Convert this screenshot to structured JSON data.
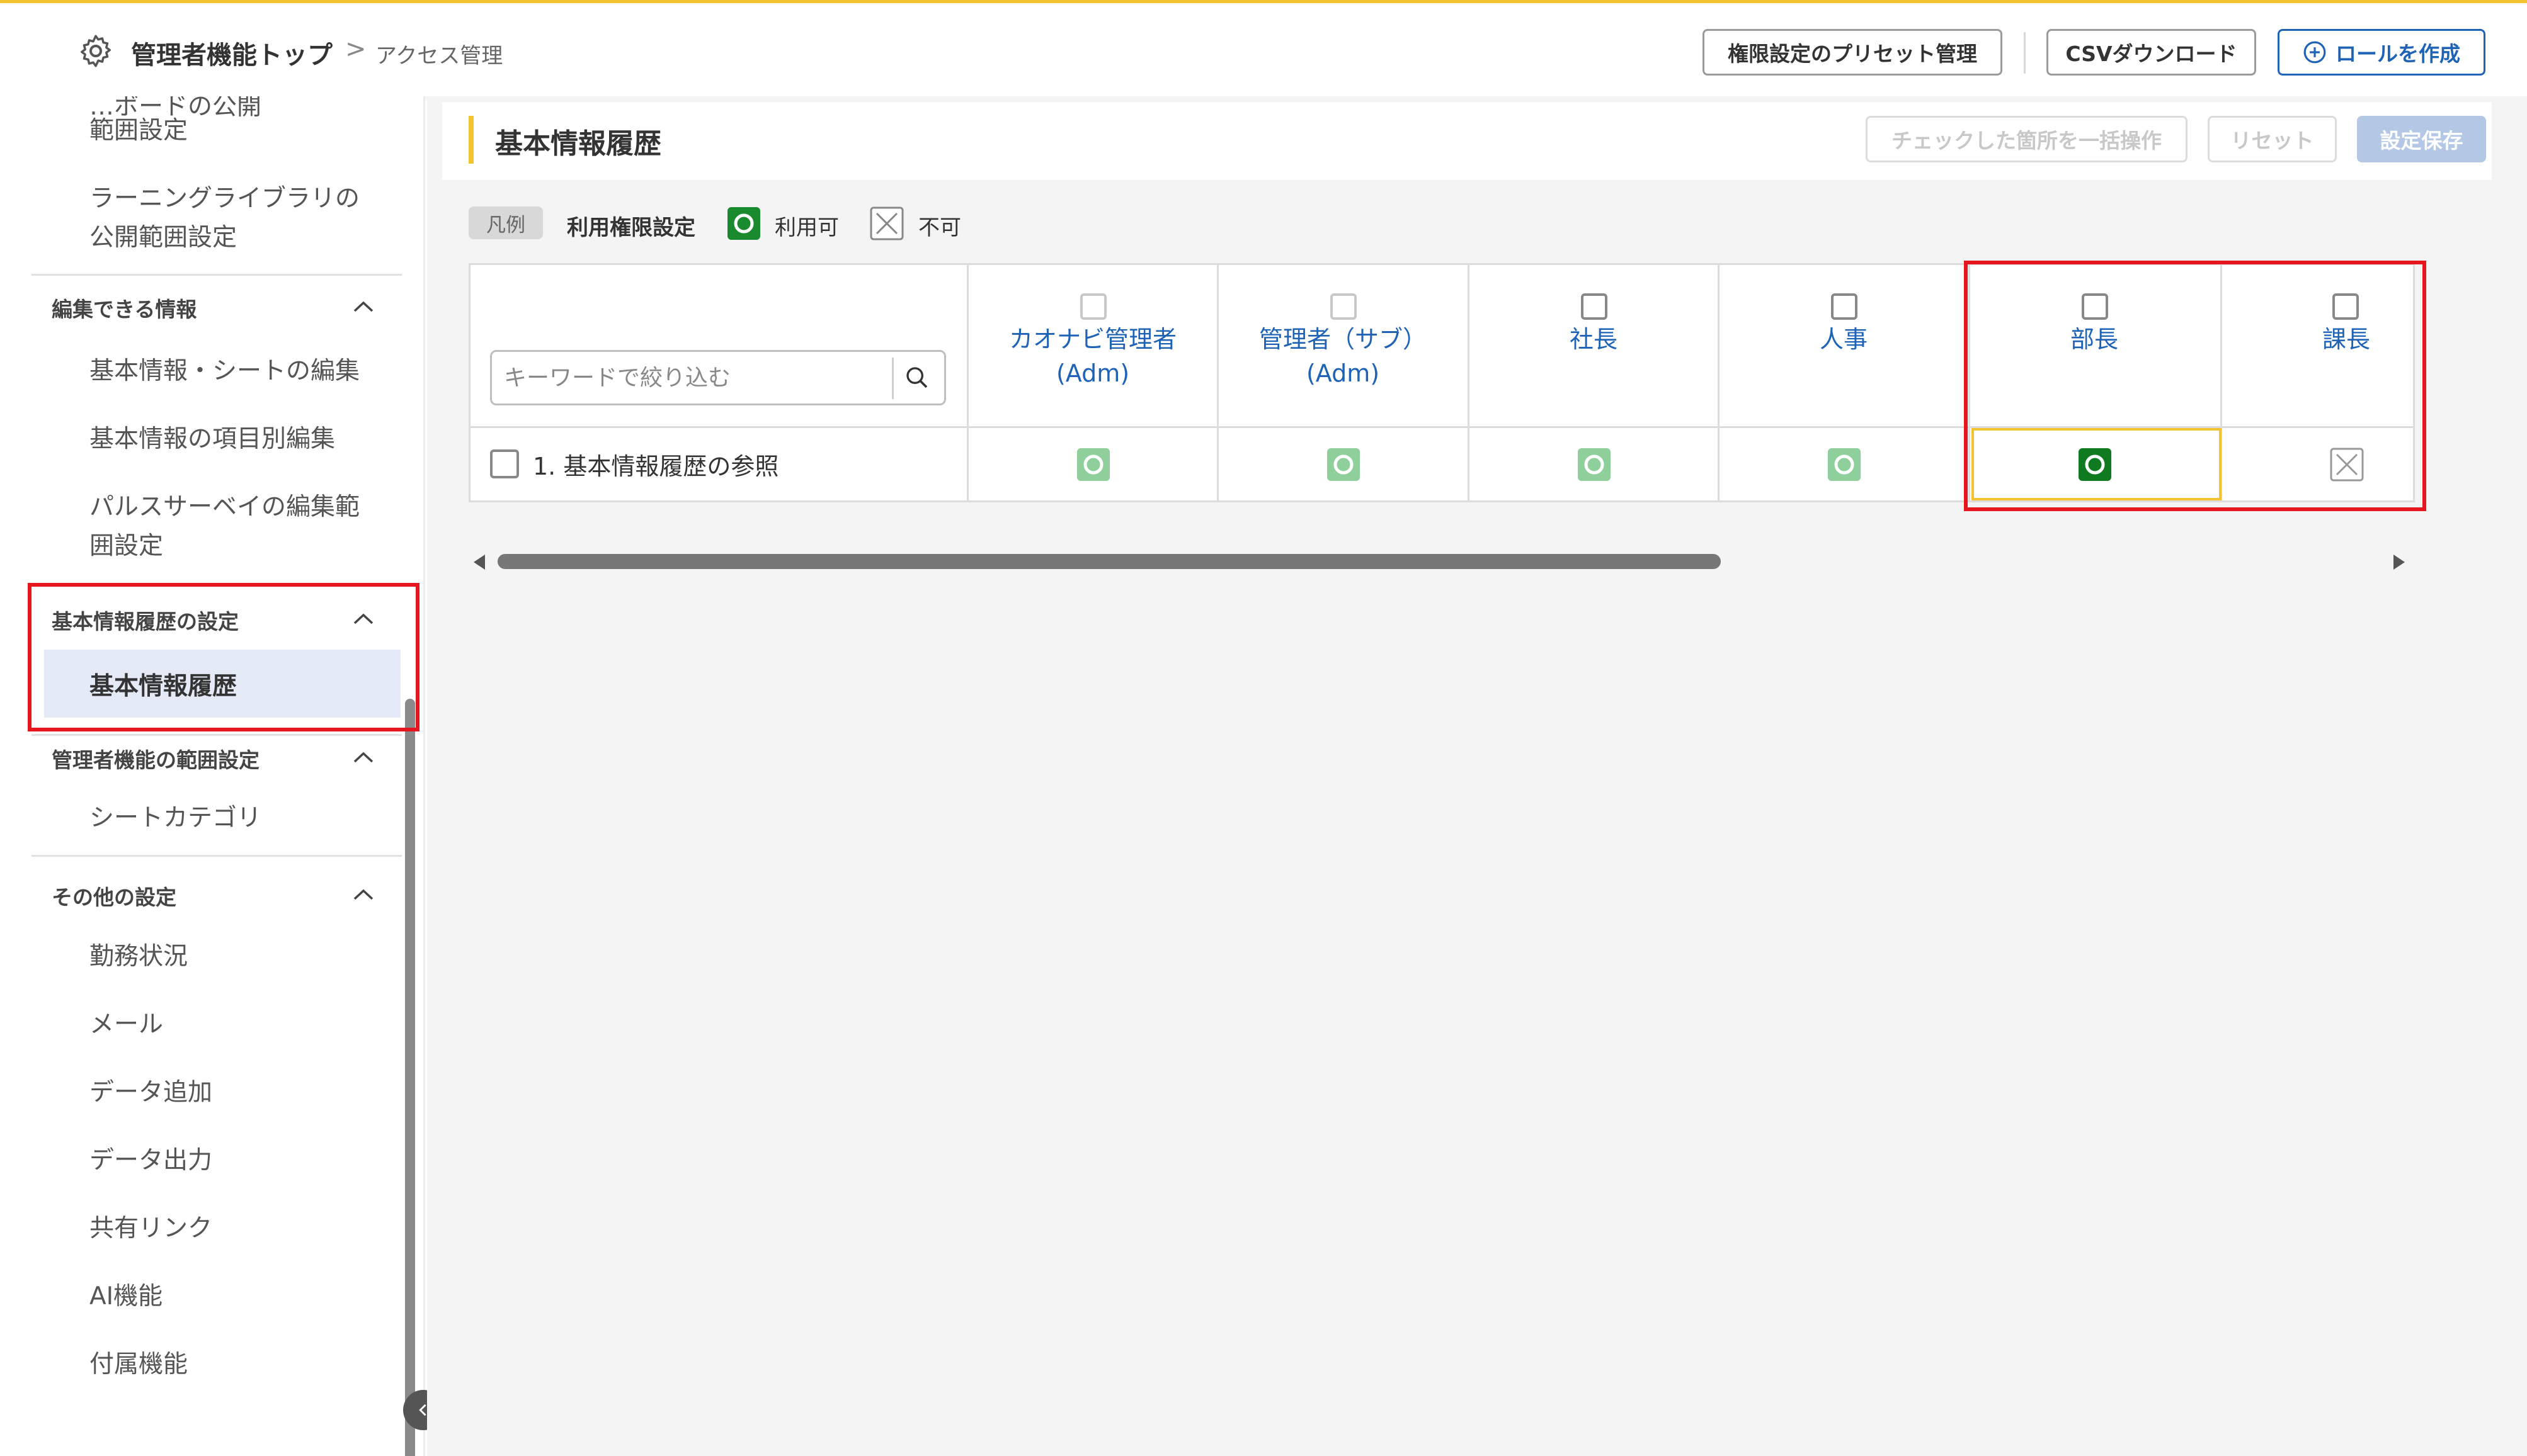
{
  "header": {
    "title": "管理者機能トップ",
    "separator": ">",
    "breadcrumb": "アクセス管理",
    "preset_button": "権限設定のプリセット管理",
    "csv_button": "CSVダウンロード",
    "create_role_button": "ロールを作成"
  },
  "sidebar": {
    "cut_item_line1": "…ボードの公開",
    "cut_item_line2": "範囲設定",
    "learning_line1": "ラーニングライブラリの",
    "learning_line2": "公開範囲設定",
    "sections": [
      {
        "heading": "編集できる情報",
        "items": [
          "基本情報・シートの編集",
          "基本情報の項目別編集",
          "パルスサーベイの編集範",
          "囲設定"
        ]
      },
      {
        "heading": "基本情報履歴の設定",
        "items": [
          "基本情報履歴"
        ]
      },
      {
        "heading": "管理者機能の範囲設定",
        "items": [
          "シートカテゴリ"
        ]
      },
      {
        "heading": "その他の設定",
        "items": [
          "勤務状況",
          "メール",
          "データ追加",
          "データ出力",
          "共有リンク",
          "AI機能",
          "付属機能"
        ]
      }
    ]
  },
  "main": {
    "title": "基本情報履歴",
    "bulk_button": "チェックした箇所を一括操作",
    "reset_button": "リセット",
    "save_button": "設定保存",
    "legend": {
      "chip": "凡例",
      "label": "利用権限設定",
      "allowed": "利用可",
      "denied": "不可"
    },
    "search_placeholder": "キーワードで絞り込む",
    "columns": [
      {
        "line1": "カオナビ管理者",
        "line2": "(Adm)"
      },
      {
        "line1": "管理者（サブ）",
        "line2": "(Adm)"
      },
      {
        "line1": "社長",
        "line2": ""
      },
      {
        "line1": "人事",
        "line2": ""
      },
      {
        "line1": "部長",
        "line2": ""
      },
      {
        "line1": "課長",
        "line2": ""
      }
    ],
    "rows": [
      {
        "label": "1. 基本情報履歴の参照",
        "permissions": [
          "allowed-locked",
          "allowed-locked",
          "allowed-locked",
          "allowed-locked",
          "allowed",
          "denied"
        ]
      }
    ]
  },
  "colors": {
    "accent_yellow": "#f4c430",
    "link_blue": "#1e63b6",
    "allowed_green": "#1a8a2e",
    "allowed_light_green": "#8fcf9c",
    "highlight_red": "#e5161d",
    "active_sidebar_bg": "#e4ebf7"
  },
  "icons": {
    "header": "gear-icon",
    "create_role": "plus-circle-icon",
    "search": "search-icon",
    "section_toggle": "chevron-up-icon",
    "collapse": "chevron-left-icon"
  }
}
